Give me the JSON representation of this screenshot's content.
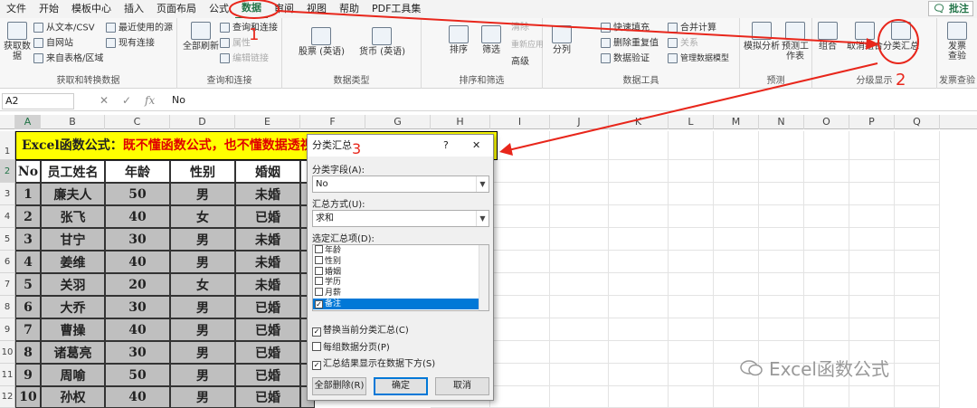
{
  "menu": {
    "tabs": [
      "文件",
      "开始",
      "模板中心",
      "插入",
      "页面布局",
      "公式",
      "数据",
      "审阅",
      "视图",
      "帮助",
      "PDF工具集"
    ],
    "active": "数据",
    "comment_btn": "批注"
  },
  "ribbon": {
    "get_data": {
      "big": "获取数据",
      "items": [
        "从文本/CSV",
        "自网站",
        "来自表格/区域",
        "最近使用的源",
        "现有连接"
      ],
      "label": "获取和转换数据"
    },
    "queries": {
      "big": "全部刷新",
      "items": [
        "查询和连接",
        "属性",
        "编辑链接"
      ],
      "label": "查询和连接"
    },
    "datatypes": {
      "items": [
        "股票 (英语)",
        "货币 (英语)"
      ],
      "label": "数据类型"
    },
    "sort": {
      "items": [
        "排序",
        "筛选",
        "清除",
        "重新应用",
        "高级"
      ],
      "label": "排序和筛选"
    },
    "tools": {
      "items": [
        "分列",
        "快速填充",
        "删除重复值",
        "数据验证",
        "合并计算",
        "关系",
        "管理数据模型"
      ],
      "label": "数据工具"
    },
    "forecast": {
      "items": [
        "模拟分析",
        "预测工作表"
      ],
      "label": "预测"
    },
    "outline": {
      "items": [
        "组合",
        "取消组合",
        "分类汇总"
      ],
      "label": "分级显示"
    },
    "review": {
      "items": [
        "发票查验"
      ],
      "label": "发票查验"
    }
  },
  "formula_bar": {
    "cell": "A2",
    "fx": "fx",
    "content": "No"
  },
  "columns": [
    "A",
    "B",
    "C",
    "D",
    "E",
    "F",
    "G",
    "H",
    "I",
    "J",
    "K",
    "L",
    "M",
    "N",
    "O",
    "P",
    "Q"
  ],
  "rows": [
    "1",
    "2",
    "3",
    "4",
    "5",
    "6",
    "7",
    "8",
    "9",
    "10",
    "11",
    "12"
  ],
  "sheet": {
    "title_black": "Excel函数公式：",
    "title_red": "既不懂函数公式，也不懂数据透视表",
    "headers": [
      "No",
      "员工姓名",
      "年龄",
      "性别",
      "婚姻"
    ],
    "data": [
      [
        "1",
        "廉夫人",
        "50",
        "男",
        "未婚"
      ],
      [
        "2",
        "张飞",
        "40",
        "女",
        "已婚"
      ],
      [
        "3",
        "甘宁",
        "30",
        "男",
        "未婚"
      ],
      [
        "4",
        "姜维",
        "40",
        "男",
        "未婚"
      ],
      [
        "5",
        "关羽",
        "20",
        "女",
        "未婚"
      ],
      [
        "6",
        "大乔",
        "30",
        "男",
        "已婚"
      ],
      [
        "7",
        "曹操",
        "40",
        "男",
        "已婚"
      ],
      [
        "8",
        "诸葛亮",
        "30",
        "男",
        "已婚"
      ],
      [
        "9",
        "周喻",
        "50",
        "男",
        "已婚"
      ],
      [
        "10",
        "孙权",
        "40",
        "男",
        "已婚"
      ]
    ]
  },
  "dialog": {
    "title": "分类汇总",
    "help": "?",
    "close": "✕",
    "field_label": "分类字段(A):",
    "field_value": "No",
    "method_label": "汇总方式(U):",
    "method_value": "求和",
    "items_label": "选定汇总项(D):",
    "items": [
      {
        "label": "年龄",
        "checked": false
      },
      {
        "label": "性别",
        "checked": false
      },
      {
        "label": "婚姻",
        "checked": false
      },
      {
        "label": "学历",
        "checked": false
      },
      {
        "label": "月薪",
        "checked": false
      },
      {
        "label": "备注",
        "checked": true
      }
    ],
    "check1": "替换当前分类汇总(C)",
    "check2": "每组数据分页(P)",
    "check3": "汇总结果显示在数据下方(S)",
    "btn_remove": "全部删除(R)",
    "btn_ok": "确定",
    "btn_cancel": "取消"
  },
  "annotations": {
    "n1": "1",
    "n2": "2",
    "n3": "3",
    "color": "#e8261b"
  },
  "watermark": "Excel函数公式"
}
